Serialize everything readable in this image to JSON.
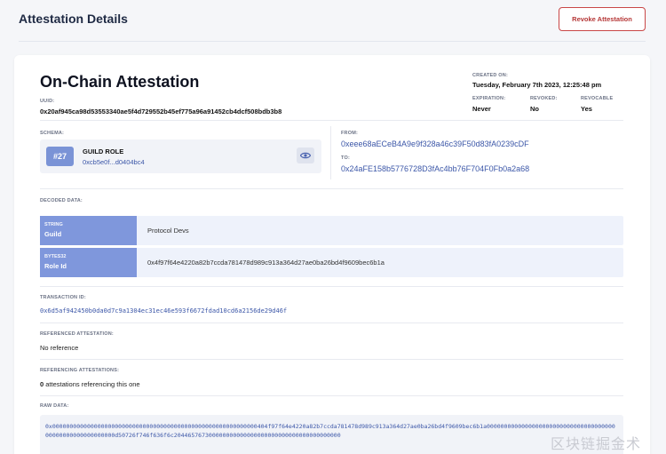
{
  "header": {
    "title": "Attestation Details",
    "revoke_label": "Revoke Attestation"
  },
  "attestation": {
    "title": "On-Chain Attestation",
    "uuid_label": "UUID:",
    "uuid": "0x20af945ca98d53553340ae5f4d729552b45ef775a96a91452cb4dcf508bdb3b8",
    "created_label": "CREATED ON:",
    "created": "Tuesday, February 7th 2023, 12:25:48 pm",
    "expiration_label": "EXPIRATION:",
    "expiration": "Never",
    "revoked_label": "REVOKED:",
    "revoked": "No",
    "revocable_label": "REVOCABLE",
    "revocable": "Yes"
  },
  "schema": {
    "label": "SCHEMA:",
    "number": "#27",
    "name": "GUILD ROLE",
    "uid": "0xcb5e0f...d0404bc4",
    "eye_icon": "eye-icon"
  },
  "parties": {
    "from_label": "FROM:",
    "from": "0xeee68aECeB4A9e9f328a46c39F50d83fA0239cDF",
    "to_label": "TO:",
    "to": "0x24aFE158b5776728D3fAc4bb76F704F0Fb0a2a68"
  },
  "decoded": {
    "label": "DECODED DATA:",
    "rows": [
      {
        "type": "STRING",
        "name": "Guild",
        "value": "Protocol Devs"
      },
      {
        "type": "BYTES32",
        "name": "Role Id",
        "value": "0x4f97f64e4220a82b7ccda781478d989c913a364d27ae0ba26bd4f9609bec6b1a"
      }
    ]
  },
  "transaction": {
    "label": "TRANSACTION ID:",
    "id": "0x6d5af942450b0da0d7c9a1304ec31ec46e593f6672fdad10cd6a2156de29d46f"
  },
  "referenced": {
    "label": "REFERENCED ATTESTATION:",
    "value": "No reference"
  },
  "referencing": {
    "label": "REFERENCING ATTESTATIONS:",
    "count": "0",
    "suffix": "attestations referencing this one"
  },
  "raw": {
    "label": "RAW DATA:",
    "value": "0x00000000000000000000000000000000000000000000000000000000000404f97f64e4220a82b7ccda781478d989c913a364d27ae0ba26bd4f9609bec6b1a000000000000000000000000000000000000000000000000000000000d50726f746f636f6c204465767300000000000000000000000000000000000000"
  },
  "watermark": "区块链掘金术"
}
